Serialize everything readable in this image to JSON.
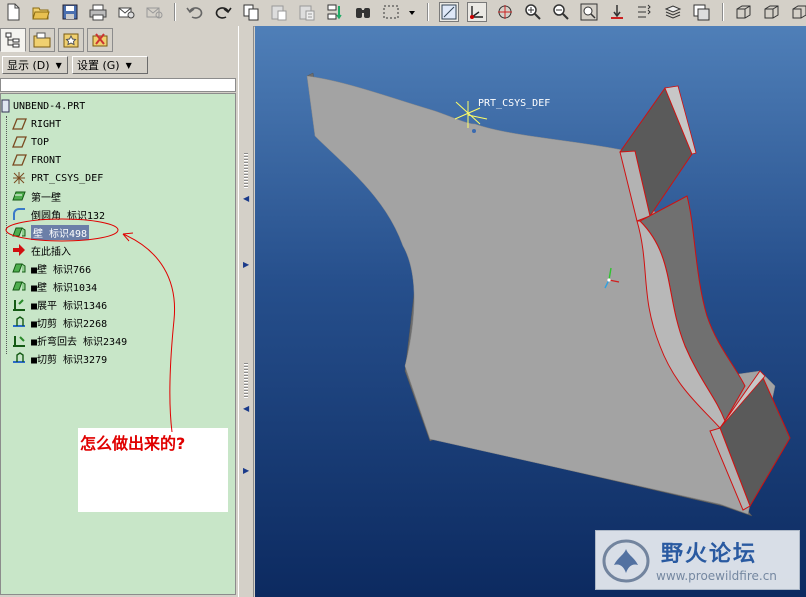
{
  "toolbar": {
    "icons": [
      "new-icon",
      "open-icon",
      "save-icon",
      "print-icon",
      "email-icon",
      "email-disabled-icon",
      "undo-icon",
      "redo-icon",
      "copy-icon",
      "paste-icon",
      "paste-special-icon",
      "regenerate-icon",
      "find-icon",
      "select-box-icon",
      "datum-display-icon",
      "csys-display-icon",
      "spin-center-icon",
      "zoom-in-icon",
      "zoom-out-icon",
      "refit-icon",
      "orient-icon",
      "saved-views-icon",
      "layers-icon",
      "view-manager-icon",
      "shading-icon",
      "wireframe-icon"
    ]
  },
  "navigator": {
    "tabs": [
      "model-tree-tab",
      "folder-browser-tab",
      "favorites-tab",
      "connections-tab"
    ],
    "show_menu": "显示 (D)",
    "settings_menu": "设置 (G)"
  },
  "tree": {
    "root": "UNBEND-4.PRT",
    "items": [
      {
        "label": "RIGHT",
        "icon": "datum-plane-icon"
      },
      {
        "label": "TOP",
        "icon": "datum-plane-icon"
      },
      {
        "label": "FRONT",
        "icon": "datum-plane-icon"
      },
      {
        "label": "PRT_CSYS_DEF",
        "icon": "csys-icon"
      },
      {
        "label": "第一壁",
        "icon": "first-wall-icon"
      },
      {
        "label": "倒圆角 标识132",
        "icon": "round-icon"
      },
      {
        "label": "壁 标识498",
        "icon": "wall-icon",
        "selected": true
      },
      {
        "label": "在此插入",
        "icon": "insert-here-arrow-icon"
      },
      {
        "label": "■壁 标识766",
        "icon": "wall-icon"
      },
      {
        "label": "■壁 标识1034",
        "icon": "wall-icon"
      },
      {
        "label": "■展平 标识1346",
        "icon": "unbend-icon"
      },
      {
        "label": "■切剪 标识2268",
        "icon": "cut-icon"
      },
      {
        "label": "■折弯回去 标识2349",
        "icon": "bend-back-icon"
      },
      {
        "label": "■切剪 标识3279",
        "icon": "cut-icon"
      }
    ]
  },
  "annotation": {
    "text": "怎么做出来的?",
    "color": "#e00000"
  },
  "viewport": {
    "csys_label": "PRT_CSYS_DEF",
    "background_top": "#4f7fb8",
    "background_bottom": "#0c2a60"
  },
  "watermark": {
    "title": "野火论坛",
    "url": "www.proewildfire.cn"
  }
}
